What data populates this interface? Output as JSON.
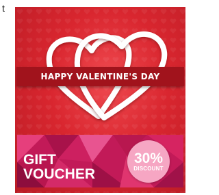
{
  "corner_text": "t",
  "card": {
    "banner_title": "HAPPY VALENTINE'S DAY",
    "background_color": "#d9262f",
    "heart_color": "#ffffff"
  },
  "voucher": {
    "line1": "GIFT",
    "line2": "VOUCHER",
    "badge_percent": "30%",
    "badge_label": "DISCOUNT",
    "accent_color": "#e0256f"
  }
}
